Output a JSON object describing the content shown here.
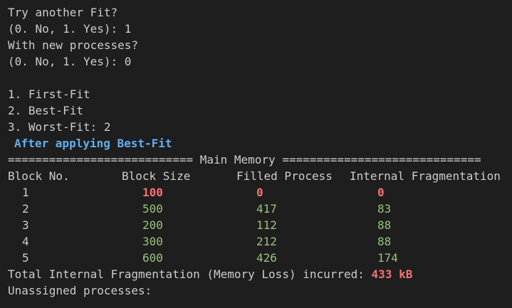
{
  "prompts": [
    "Try another Fit?",
    "(0. No, 1. Yes): 1",
    "With new processes?",
    "(0. No, 1. Yes): 0"
  ],
  "menu": [
    "1. First-Fit",
    "2. Best-Fit",
    "3. Worst-Fit: 2"
  ],
  "heading": "After applying Best-Fit",
  "separator": "=========================== Main Memory =============================",
  "table": {
    "headers": [
      "Block No.",
      "Block Size",
      "Filled Process",
      "Internal Fragmentation"
    ],
    "rows": [
      {
        "block": "1",
        "size": "100",
        "process": "0",
        "frag": "0",
        "status": "unfilled"
      },
      {
        "block": "2",
        "size": "500",
        "process": "417",
        "frag": "83",
        "status": "filled"
      },
      {
        "block": "3",
        "size": "200",
        "process": "112",
        "frag": "88",
        "status": "filled"
      },
      {
        "block": "4",
        "size": "300",
        "process": "212",
        "frag": "88",
        "status": "filled"
      },
      {
        "block": "5",
        "size": "600",
        "process": "426",
        "frag": "174",
        "status": "filled"
      }
    ]
  },
  "total_label": "Total Internal Fragmentation (Memory Loss) incurred: ",
  "total_value": "433 kB",
  "unassigned_label": "Unassigned processes:",
  "colors": {
    "background": "#1e1e1e",
    "text": "#cccccc",
    "heading": "#61afef",
    "unfilled": "#f47174",
    "filled": "#98c379"
  }
}
